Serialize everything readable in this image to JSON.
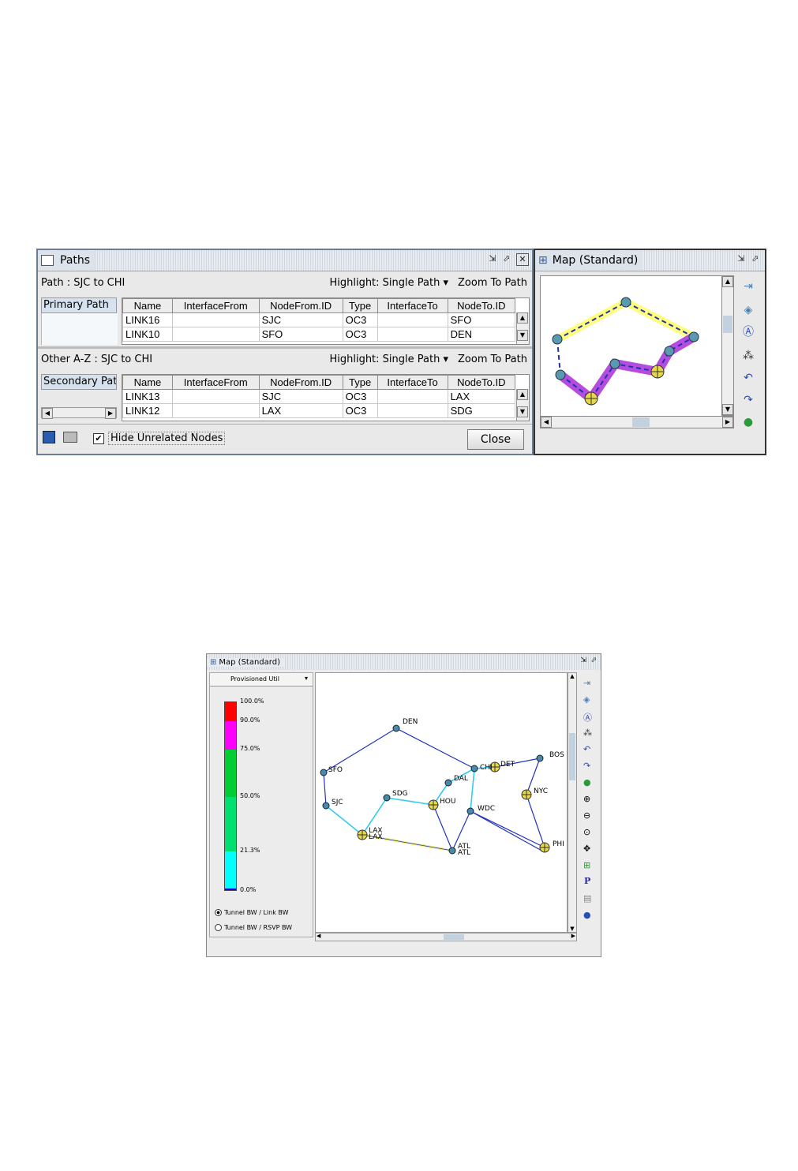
{
  "paths_window": {
    "title": "Paths",
    "path_header": "Path : SJC to CHI",
    "highlight_label": "Highlight: Single Path",
    "zoom_label": "Zoom To Path",
    "primary_tab": "Primary Path",
    "other_header": "Other A-Z : SJC to CHI",
    "secondary_tab": "Secondary Path",
    "columns": [
      "Name",
      "InterfaceFrom",
      "NodeFrom.ID",
      "Type",
      "InterfaceTo",
      "NodeTo.ID"
    ],
    "primary_rows": [
      [
        "LINK16",
        "",
        "SJC",
        "OC3",
        "",
        "SFO"
      ],
      [
        "LINK10",
        "",
        "SFO",
        "OC3",
        "",
        "DEN"
      ]
    ],
    "secondary_rows": [
      [
        "LINK13",
        "",
        "SJC",
        "OC3",
        "",
        "LAX"
      ],
      [
        "LINK12",
        "",
        "LAX",
        "OC3",
        "",
        "SDG"
      ]
    ],
    "hide_unrelated_label": "Hide Unrelated Nodes",
    "hide_unrelated_checked": true,
    "close_label": "Close"
  },
  "small_map": {
    "title": "Map (Standard)"
  },
  "big_map": {
    "title": "Map (Standard)",
    "dropdown_value": "Provisioned Util",
    "legend": [
      "100.0%",
      "90.0%",
      "75.0%",
      "50.0%",
      "21.3%",
      "0.0%"
    ],
    "legend_colors": [
      "#ff0000",
      "#ff00ff",
      "#00cc00",
      "#00e070",
      "#00ffff",
      "#0000ff"
    ],
    "radio_options": [
      "Tunnel BW / Link BW",
      "Tunnel BW / RSVP BW"
    ],
    "radio_selected": 0,
    "nodes": [
      "DEN",
      "SFO",
      "SJC",
      "SDG",
      "LAX",
      "LAX",
      "HOU",
      "DAL",
      "CHI",
      "DET",
      "BOS",
      "NYC",
      "WDC",
      "ATL",
      "ATL",
      "PHI"
    ]
  },
  "toolbar_icons": [
    "open-icon",
    "shield-icon",
    "person-icon",
    "layout-icon",
    "undo-icon",
    "redo-icon",
    "globe-icon"
  ],
  "big_toolbar_icons": [
    "open-icon",
    "shield-icon",
    "person-icon",
    "layout-icon",
    "undo-icon",
    "redo-icon",
    "globe-icon",
    "zoom-in-icon",
    "zoom-out-icon",
    "zoom-fit-icon",
    "pan-icon",
    "select-icon",
    "p-icon",
    "note-icon",
    "help-icon"
  ],
  "big_toolbar_p_glyph": "P"
}
